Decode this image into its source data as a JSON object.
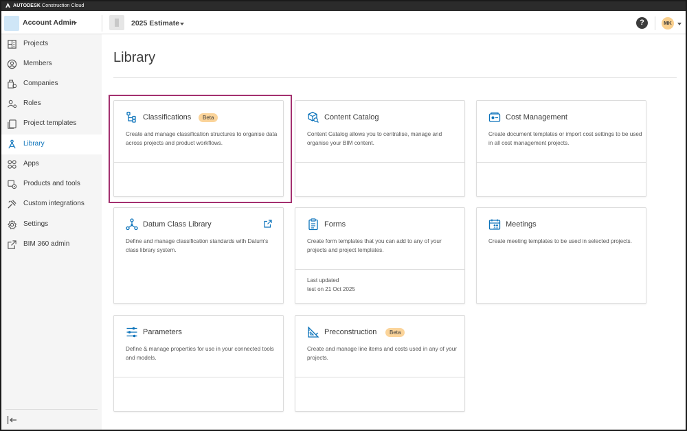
{
  "brand": {
    "name": "AUTODESK",
    "product": "Construction Cloud"
  },
  "topbar": {
    "account_name": "Account Admin",
    "project_name": "2025 Estimate",
    "help_label": "?",
    "avatar_initials": "MK"
  },
  "sidebar": {
    "items": [
      {
        "label": "Projects",
        "icon": "projects-icon",
        "active": false
      },
      {
        "label": "Members",
        "icon": "members-icon",
        "active": false
      },
      {
        "label": "Companies",
        "icon": "companies-icon",
        "active": false
      },
      {
        "label": "Roles",
        "icon": "roles-icon",
        "active": false
      },
      {
        "label": "Project templates",
        "icon": "project-templates-icon",
        "active": false
      },
      {
        "label": "Library",
        "icon": "library-icon",
        "active": true
      },
      {
        "label": "Apps",
        "icon": "apps-icon",
        "active": false
      },
      {
        "label": "Products and tools",
        "icon": "products-tools-icon",
        "active": false
      },
      {
        "label": "Custom integrations",
        "icon": "custom-integrations-icon",
        "active": false
      },
      {
        "label": "Settings",
        "icon": "settings-icon",
        "active": false
      },
      {
        "label": "BIM 360 admin",
        "icon": "external-link-icon",
        "active": false
      }
    ],
    "collapse_icon": "collapse-sidebar-icon"
  },
  "main": {
    "title": "Library",
    "cards": [
      {
        "title": "Classifications",
        "badge": "Beta",
        "description": "Create and manage classification structures to organise data across projects and product workflows.",
        "icon": "classifications-icon",
        "highlighted": true
      },
      {
        "title": "Content Catalog",
        "description": "Content Catalog allows you to centralise, manage and organise your BIM content.",
        "icon": "content-catalog-icon"
      },
      {
        "title": "Cost Management",
        "description": "Create document templates or import cost settings to be used in all cost management projects.",
        "icon": "cost-management-icon"
      },
      {
        "title": "Datum Class Library",
        "description": "Define and manage classification standards with Datum's class library system.",
        "icon": "datum-class-library-icon",
        "external_icon": "external-link-icon"
      },
      {
        "title": "Forms",
        "description": "Create form templates that you can add to any of your projects and project templates.",
        "icon": "forms-icon",
        "footer_label": "Last updated",
        "footer_value": "test on 21 Oct 2025"
      },
      {
        "title": "Meetings",
        "description": "Create meeting templates to be used in selected projects.",
        "icon": "meetings-icon"
      },
      {
        "title": "Parameters",
        "description": "Define & manage properties for use in your connected tools and models.",
        "icon": "parameters-icon"
      },
      {
        "title": "Preconstruction",
        "badge": "Beta",
        "description": "Create and manage line items and costs used in any of your projects.",
        "icon": "preconstruction-icon"
      }
    ]
  },
  "colors": {
    "accent": "#0a72ba",
    "highlight_border": "#a3306f",
    "beta_badge": "#fbd49a",
    "sidebar_bg": "#f5f5f5",
    "avatar_bg": "#f9cf8d"
  }
}
